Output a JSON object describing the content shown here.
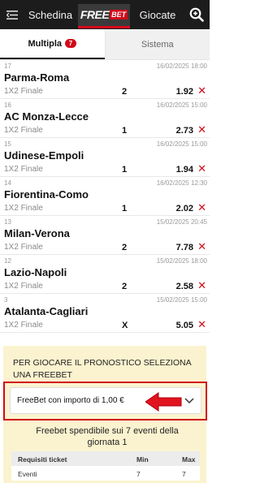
{
  "header": {
    "schedina_label": "Schedina",
    "freebet_free": "FREE",
    "freebet_bet": "BET",
    "giocate_label": "Giocate"
  },
  "tabs": {
    "multipla_label": "Multipla",
    "multipla_count": "7",
    "sistema_label": "Sistema"
  },
  "events": [
    {
      "num": "17",
      "date": "16/02/2025 18:00",
      "teams": "Parma-Roma",
      "market": "1X2 Finale",
      "sign": "2",
      "odd": "1.92"
    },
    {
      "num": "16",
      "date": "16/02/2025 15:00",
      "teams": "AC Monza-Lecce",
      "market": "1X2 Finale",
      "sign": "1",
      "odd": "2.73"
    },
    {
      "num": "15",
      "date": "16/02/2025 15:00",
      "teams": "Udinese-Empoli",
      "market": "1X2 Finale",
      "sign": "1",
      "odd": "1.94"
    },
    {
      "num": "14",
      "date": "16/02/2025 12:30",
      "teams": "Fiorentina-Como",
      "market": "1X2 Finale",
      "sign": "1",
      "odd": "2.02"
    },
    {
      "num": "13",
      "date": "15/02/2025 20:45",
      "teams": "Milan-Verona",
      "market": "1X2 Finale",
      "sign": "2",
      "odd": "7.78"
    },
    {
      "num": "12",
      "date": "15/02/2025 18:00",
      "teams": "Lazio-Napoli",
      "market": "1X2 Finale",
      "sign": "2",
      "odd": "2.58"
    },
    {
      "num": "3",
      "date": "15/02/2025 15:00",
      "teams": "Atalanta-Cagliari",
      "market": "1X2 Finale",
      "sign": "X",
      "odd": "5.05"
    }
  ],
  "freebet_panel": {
    "title": "PER GIOCARE IL PRONOSTICO SELEZIONA UNA FREEBET",
    "selected_option": "FreeBet con importo di 1,00 €",
    "spend_text": "Freebet spendibile sui 7 eventi della giornata 1",
    "table_headers": [
      "Requisiti ticket",
      "Min",
      "Max"
    ],
    "table_rows": [
      [
        "Eventi",
        "7",
        "7"
      ]
    ]
  },
  "colors": {
    "accent": "#d10a19",
    "topbar": "#1c1c1c",
    "panel_bg": "#fbf3cf"
  }
}
